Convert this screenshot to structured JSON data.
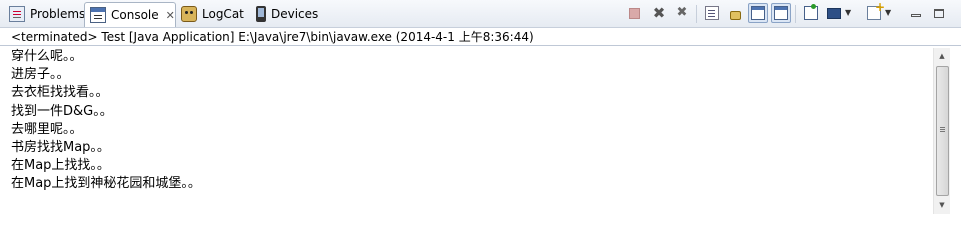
{
  "tabs": [
    {
      "label": "Problems",
      "icon": "problems-icon",
      "active": false
    },
    {
      "label": "Console",
      "icon": "console-icon",
      "active": true,
      "close": "✕"
    },
    {
      "label": "LogCat",
      "icon": "logcat-icon",
      "active": false
    },
    {
      "label": "Devices",
      "icon": "devices-icon",
      "active": false
    }
  ],
  "toolbar": {
    "icons": [
      "terminate-icon",
      "remove-launch-icon",
      "remove-all-terminated-icon",
      "clear-console-icon",
      "scroll-lock-icon",
      "show-on-stdout-icon",
      "show-on-stderr-icon",
      "pin-console-icon",
      "display-console-icon",
      "dropdown-icon",
      "open-console-icon",
      "dropdown-icon",
      "minimize-icon",
      "maximize-icon"
    ]
  },
  "status": "<terminated> Test [Java Application] E:\\Java\\jre7\\bin\\javaw.exe (2014-4-1 上午8:36:44)",
  "output": [
    "穿什么呢。。",
    "进房子。。",
    "去衣柜找找看。。",
    "找到一件D&G。。",
    "去哪里呢。。",
    "书房找找Map。。",
    "在Map上找找。。",
    "在Map上找到神秘花园和城堡。。"
  ],
  "scrollbar": {
    "up": "▲",
    "down": "▼"
  }
}
